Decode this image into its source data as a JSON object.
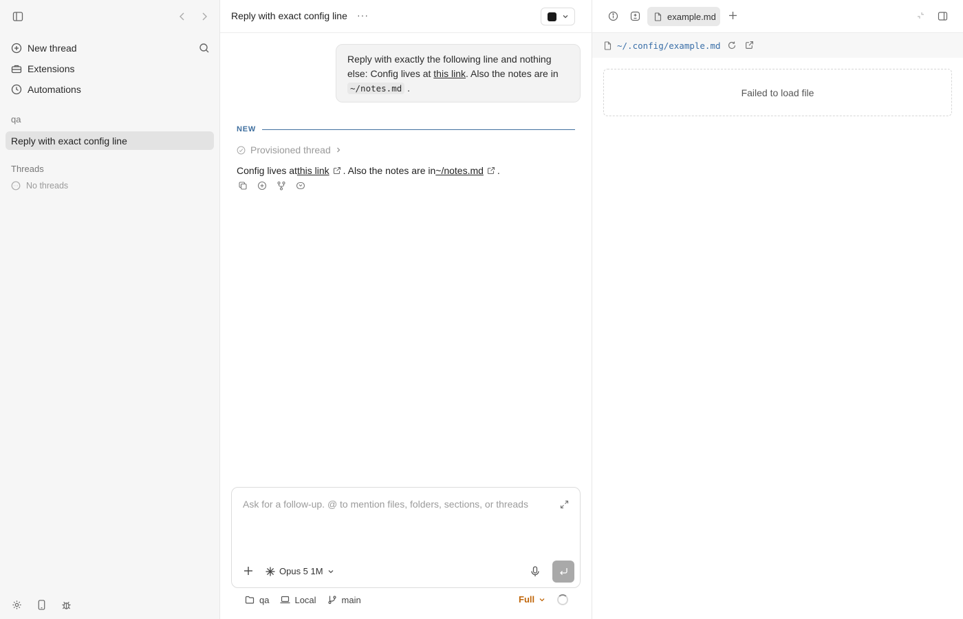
{
  "sidebar": {
    "nav": [
      {
        "label": "New thread",
        "icon": "plus-circle-icon"
      },
      {
        "label": "Extensions",
        "icon": "toolbox-icon"
      },
      {
        "label": "Automations",
        "icon": "clock-icon"
      }
    ],
    "project_label": "qa",
    "active_thread": "Reply with exact config line",
    "threads_label": "Threads",
    "no_threads": "No threads"
  },
  "chat": {
    "title": "Reply with exact config line",
    "user_message": {
      "part1": "Reply with exactly the following line and nothing else: Config lives at ",
      "link": "this link",
      "part2": ". Also the notes are in ",
      "code": "~/notes.md",
      "part3": " ."
    },
    "new_label": "NEW",
    "provisioned": "Provisioned thread",
    "reply": {
      "part1": "Config lives at ",
      "link1": "this link",
      "part2": ". Also the notes are in ",
      "link2": "~/notes.md",
      "part3": "."
    }
  },
  "composer": {
    "placeholder": "Ask for a follow-up. @ to mention files, folders, sections, or threads",
    "model": "Opus 5 1M"
  },
  "footer": {
    "project": "qa",
    "env": "Local",
    "branch": "main",
    "mode": "Full",
    "mode_color": "#c0660a"
  },
  "panel": {
    "tab_label": "example.md",
    "path": "~/.config/example.md",
    "error": "Failed to load file"
  },
  "colors": {
    "accent_link": "#3a6fa8",
    "divider": "#3f6f9f"
  }
}
